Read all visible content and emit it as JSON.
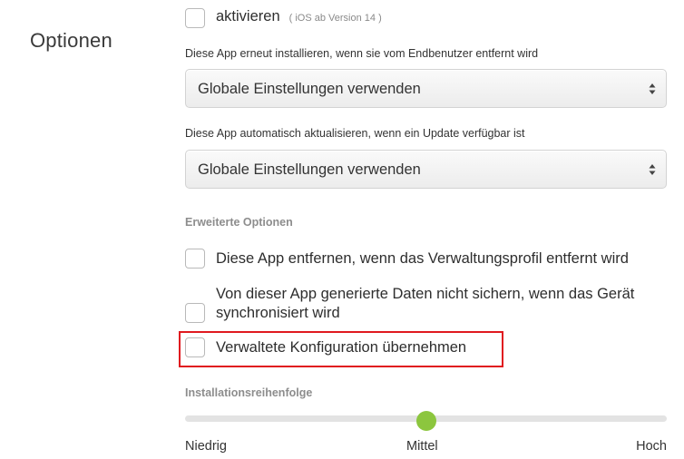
{
  "section": {
    "title": "Optionen"
  },
  "activate": {
    "label": "aktivieren",
    "hint": "( iOS ab Version 14 )"
  },
  "reinstall": {
    "label": "Diese App erneut installieren, wenn sie vom Endbenutzer entfernt wird",
    "value": "Globale Einstellungen verwenden"
  },
  "autoupdate": {
    "label": "Diese App automatisch aktualisieren, wenn ein Update verfügbar ist",
    "value": "Globale Einstellungen verwenden"
  },
  "advanced": {
    "heading": "Erweiterte Optionen",
    "remove_label": "Diese App entfernen, wenn das Verwaltungsprofil entfernt wird",
    "nobackup_line1": "Von dieser App generierte Daten nicht sichern, wenn das Gerät",
    "nobackup_line2": "synchronisiert wird",
    "managed_config_label": "Verwaltete Konfiguration übernehmen"
  },
  "install_order": {
    "heading": "Installationsreihenfolge",
    "levels": [
      "Niedrig",
      "Mittel",
      "Hoch"
    ],
    "selected": "Mittel",
    "selected_fraction": 0.5,
    "accent_color": "#8cc63e"
  },
  "colors": {
    "highlight": "#e0191f"
  }
}
